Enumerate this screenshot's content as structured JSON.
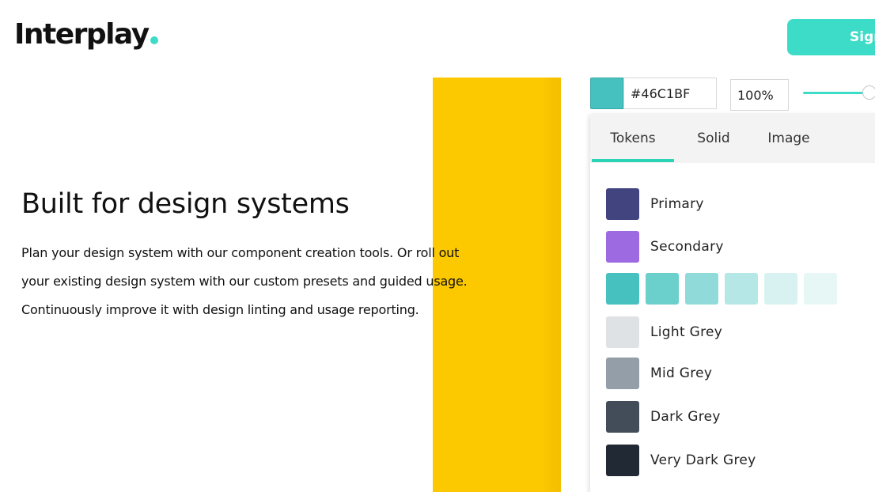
{
  "header": {
    "logo_text": "Interplay",
    "signup_label": "Sign"
  },
  "hero": {
    "title": "Built for design systems",
    "lines": [
      "Plan your design system with our component creation tools. Or roll out",
      "your existing design system with our custom presets and guided usage.",
      "Continuously improve it with design linting and usage reporting."
    ]
  },
  "picker": {
    "hex_value": "#46C1BF",
    "opacity_value": "100%",
    "opacity_level": 1.0,
    "tabs": [
      {
        "label": "Tokens"
      },
      {
        "label": "Solid"
      },
      {
        "label": "Image"
      }
    ],
    "active_tab": "Tokens",
    "tokens": [
      {
        "label": "Primary",
        "color": "#42447F"
      },
      {
        "label": "Secondary",
        "color": "#9E6AE2"
      }
    ],
    "shades": [
      "#46C1BF",
      "#6BCFCC",
      "#90DBD9",
      "#B4E7E5",
      "#D8F2F2",
      "#E6F7F6"
    ],
    "greys": [
      {
        "label": "Light Grey",
        "color": "#DFE2E5"
      },
      {
        "label": "Mid Grey",
        "color": "#939EA9"
      },
      {
        "label": "Dark Grey",
        "color": "#434D59"
      },
      {
        "label": "Very Dark Grey",
        "color": "#212A34"
      }
    ]
  },
  "colors": {
    "accent": "#3DDCC8",
    "yellow": "#FCC800"
  }
}
